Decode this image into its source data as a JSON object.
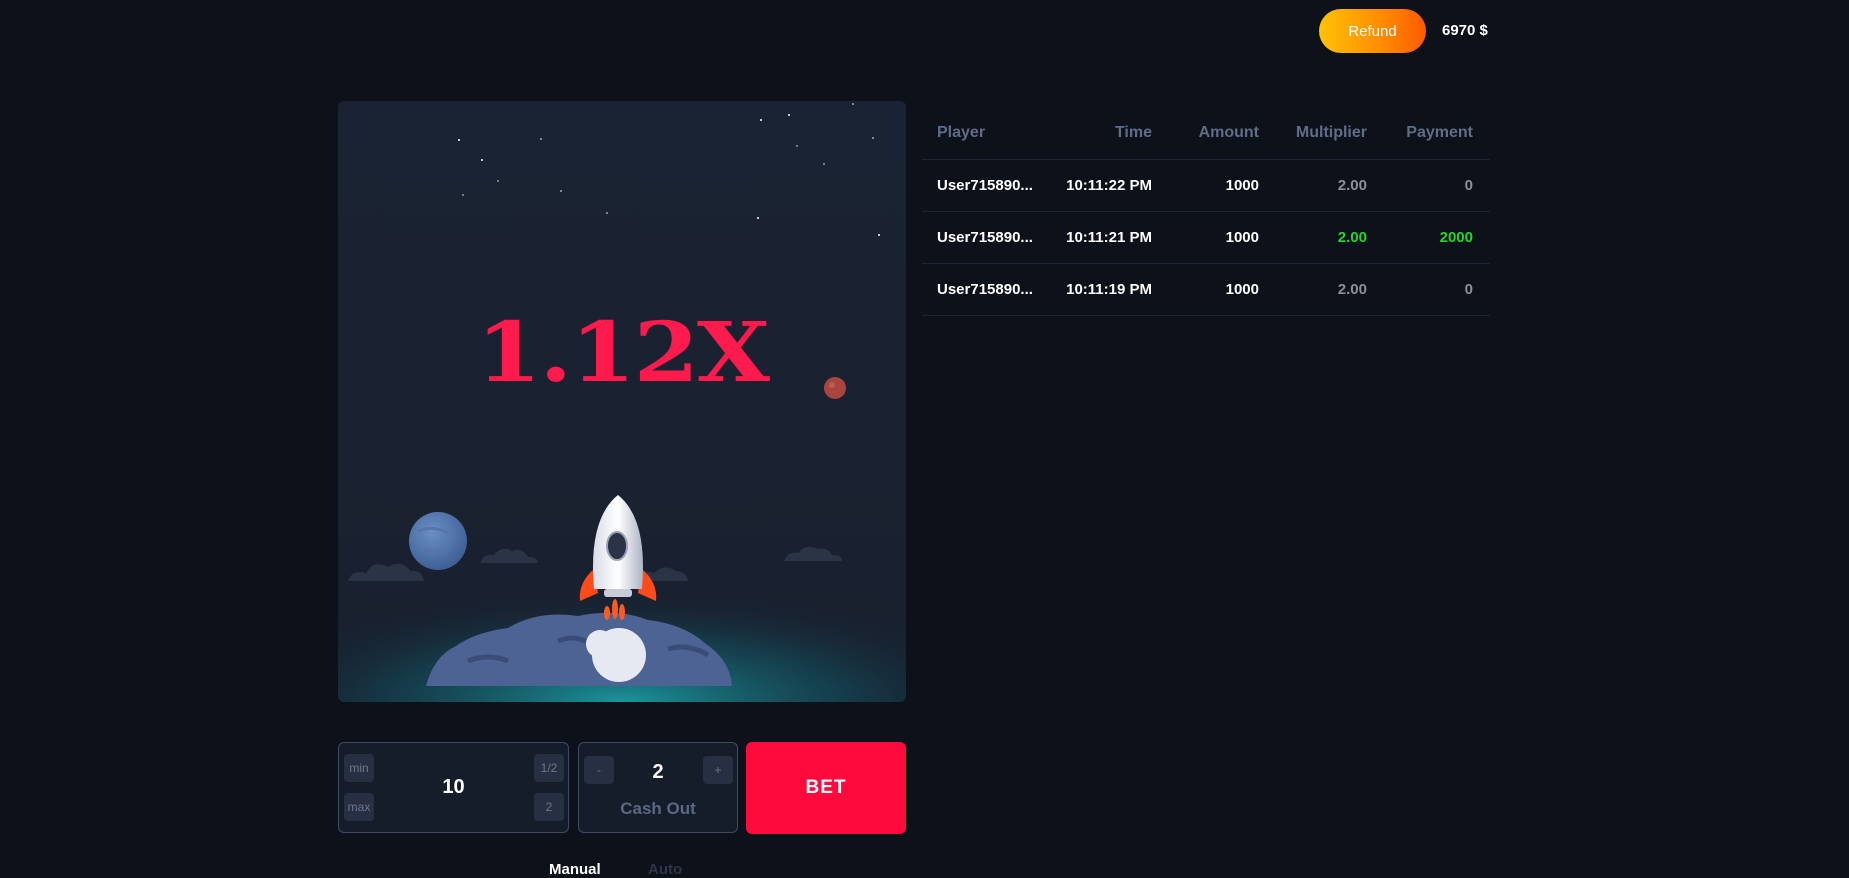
{
  "header": {
    "refund_label": "Refund",
    "balance": "6970 $"
  },
  "game": {
    "multiplier": "1.12X"
  },
  "controls": {
    "bet_min": "min",
    "bet_max": "max",
    "bet_half": "1/2",
    "bet_double": "2",
    "bet_value": "10",
    "cashout_minus": "-",
    "cashout_plus": "+",
    "cashout_value": "2",
    "cashout_label": "Cash Out",
    "bet_button": "BET",
    "tabs": [
      "Manual",
      "Auto"
    ]
  },
  "history": {
    "columns": [
      "Player",
      "Time",
      "Amount",
      "Multiplier",
      "Payment"
    ],
    "rows": [
      {
        "player": "User715890...",
        "time": "10:11:22 PM",
        "amount": "1000",
        "multiplier": "2.00",
        "payment": "0",
        "won": false
      },
      {
        "player": "User715890...",
        "time": "10:11:21 PM",
        "amount": "1000",
        "multiplier": "2.00",
        "payment": "2000",
        "won": true
      },
      {
        "player": "User715890...",
        "time": "10:11:19 PM",
        "amount": "1000",
        "multiplier": "2.00",
        "payment": "0",
        "won": false
      }
    ]
  },
  "colors": {
    "accent_red": "#ff0a3d",
    "win_green": "#21d829",
    "refund_gradient": [
      "#ffc107",
      "#ff5a00"
    ]
  }
}
